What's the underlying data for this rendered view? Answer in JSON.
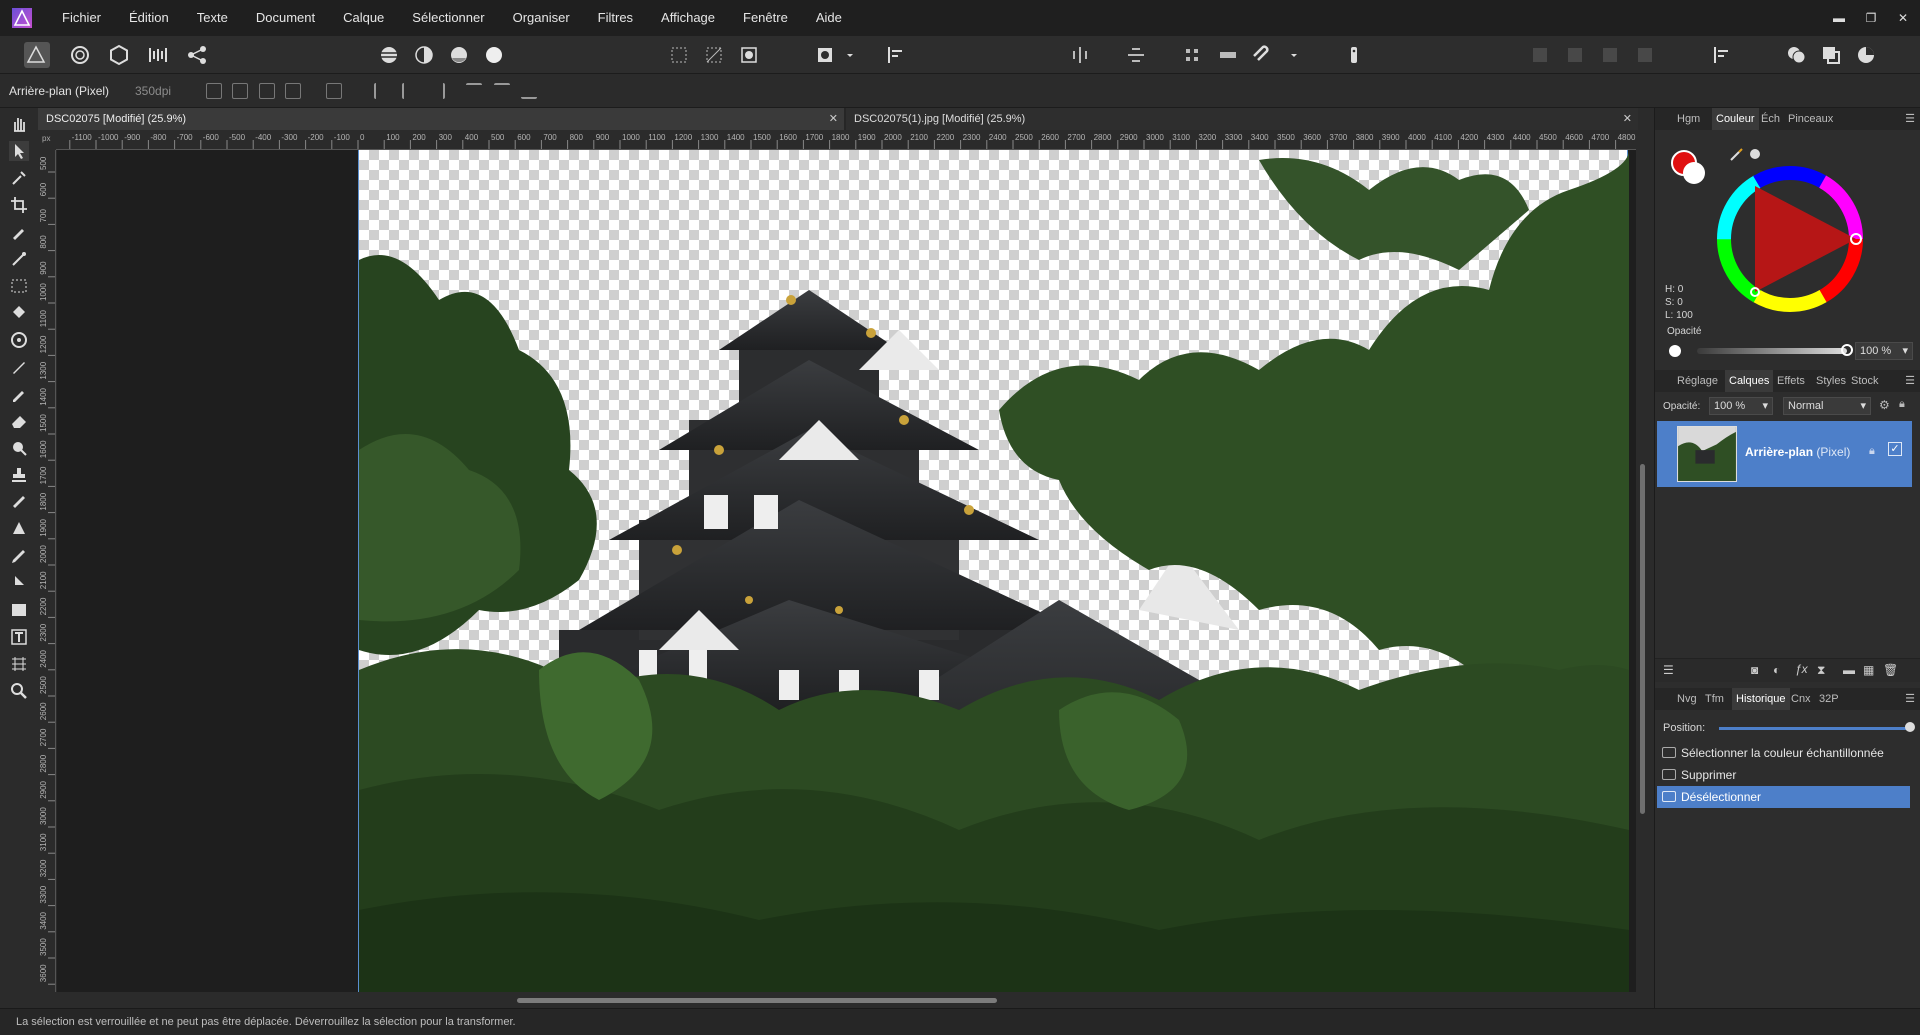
{
  "app": {
    "name": "Affinity Photo",
    "accent": "#4d7fc9"
  },
  "menu": [
    "Fichier",
    "Édition",
    "Texte",
    "Document",
    "Calque",
    "Sélectionner",
    "Organiser",
    "Filtres",
    "Affichage",
    "Fenêtre",
    "Aide"
  ],
  "window_controls": {
    "minimize": "▬",
    "maximize": "❐",
    "close": "✕"
  },
  "context": {
    "layer": "Arrière-plan (Pixel)",
    "dpi": "350dpi"
  },
  "tabs": [
    {
      "label": "DSC02075 [Modifié] (25.9%)",
      "close": "✕"
    },
    {
      "label": "DSC02075(1).jpg [Modifié] (25.9%)",
      "close": "✕"
    }
  ],
  "ruler_unit": "px",
  "hruler_ticks": [
    "-1100",
    "-1000",
    "-900",
    "-800",
    "-700",
    "-600",
    "-500",
    "-400",
    "-300",
    "-200",
    "-100",
    "0",
    "100",
    "200",
    "300",
    "400",
    "500",
    "600",
    "700",
    "800",
    "900",
    "1000",
    "1100",
    "1200",
    "1300",
    "1400",
    "1500",
    "1600",
    "1700",
    "1800",
    "1900",
    "2000",
    "2100",
    "2200",
    "2300",
    "2400",
    "2500",
    "2600",
    "2700",
    "2800",
    "2900",
    "3000",
    "3100",
    "3200",
    "3300",
    "3400",
    "3500",
    "3600",
    "3700",
    "3800",
    "3900",
    "4000",
    "4100",
    "4200",
    "4300",
    "4400",
    "4500",
    "4600",
    "4700",
    "4800"
  ],
  "vruler_ticks": [
    "500",
    "600",
    "700",
    "800",
    "900",
    "1000",
    "1100",
    "1200",
    "1300",
    "1400",
    "1500",
    "1600",
    "1700",
    "1800",
    "1900",
    "2000",
    "2100",
    "2200",
    "2300",
    "2400",
    "2500",
    "2600",
    "2700",
    "2800",
    "2900",
    "3000",
    "3100",
    "3200",
    "3300",
    "3400",
    "3500",
    "3600"
  ],
  "color_panel": {
    "tabs": [
      "Hgm",
      "Couleur",
      "Éch",
      "Pinceaux"
    ],
    "active_tab": "Couleur",
    "h": "H: 0",
    "s": "S: 0",
    "l": "L: 100",
    "opacity_label": "Opacité",
    "opacity_value": "100 %",
    "primary_color": "#e01010",
    "secondary_color": "#ffffff"
  },
  "layers_panel": {
    "tabs": [
      "Réglage",
      "Calques",
      "Effets",
      "Styles",
      "Stock"
    ],
    "active_tab": "Calques",
    "opacity_label": "Opacité:",
    "opacity_value": "100 %",
    "blend_mode": "Normal",
    "layer_name": "Arrière-plan",
    "layer_type": "(Pixel)"
  },
  "history_panel": {
    "tabs": [
      "Nvg",
      "Tfm",
      "Historique",
      "Cnx",
      "32P"
    ],
    "active_tab": "Historique",
    "position_label": "Position:",
    "position_value": 1.0,
    "items": [
      "Sélectionner la couleur échantillonnée",
      "Supprimer",
      "Désélectionner"
    ],
    "selected_index": 2
  },
  "status": "La sélection est verrouillée et ne peut pas être déplacée. Déverrouillez la sélection pour la transformer."
}
